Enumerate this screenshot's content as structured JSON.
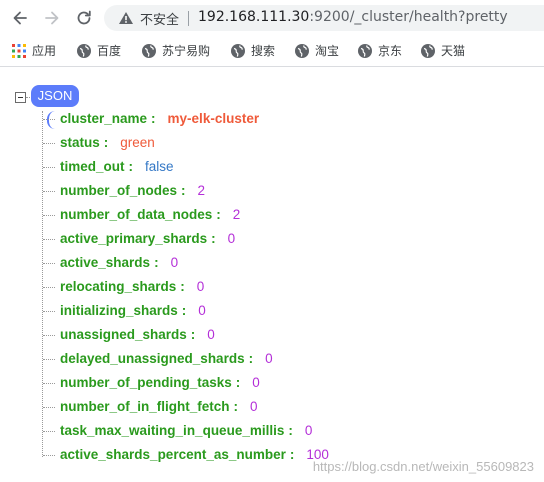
{
  "browser": {
    "security_label": "不安全",
    "url_host": "192.168.111.30",
    "url_rest": ":9200/_cluster/health?pretty"
  },
  "bookmarks": [
    {
      "label": "应用",
      "icon": "apps-grid-icon"
    },
    {
      "label": "百度",
      "icon": "globe-icon"
    },
    {
      "label": "苏宁易购",
      "icon": "globe-icon"
    },
    {
      "label": "搜索",
      "icon": "globe-icon"
    },
    {
      "label": "淘宝",
      "icon": "globe-icon"
    },
    {
      "label": "京东",
      "icon": "globe-icon"
    },
    {
      "label": "天猫",
      "icon": "globe-icon"
    }
  ],
  "json_view": {
    "badge": "JSON",
    "rows": [
      {
        "key": "cluster_name",
        "value": "my-elk-cluster",
        "type": "string-strong"
      },
      {
        "key": "status",
        "value": "green",
        "type": "string"
      },
      {
        "key": "timed_out",
        "value": "false",
        "type": "boolean"
      },
      {
        "key": "number_of_nodes",
        "value": "2",
        "type": "number"
      },
      {
        "key": "number_of_data_nodes",
        "value": "2",
        "type": "number"
      },
      {
        "key": "active_primary_shards",
        "value": "0",
        "type": "number"
      },
      {
        "key": "active_shards",
        "value": "0",
        "type": "number"
      },
      {
        "key": "relocating_shards",
        "value": "0",
        "type": "number"
      },
      {
        "key": "initializing_shards",
        "value": "0",
        "type": "number"
      },
      {
        "key": "unassigned_shards",
        "value": "0",
        "type": "number"
      },
      {
        "key": "delayed_unassigned_shards",
        "value": "0",
        "type": "number"
      },
      {
        "key": "number_of_pending_tasks",
        "value": "0",
        "type": "number"
      },
      {
        "key": "number_of_in_flight_fetch",
        "value": "0",
        "type": "number"
      },
      {
        "key": "task_max_waiting_in_queue_millis",
        "value": "0",
        "type": "number"
      },
      {
        "key": "active_shards_percent_as_number",
        "value": "100",
        "type": "number"
      }
    ]
  },
  "watermark": "https://blog.csdn.net/weixin_55609823",
  "colors": {
    "key": "#2a9a1d",
    "string": "#ef5a3a",
    "boolean": "#3478c6",
    "number": "#b42fd8",
    "badge": "#5c7cfa"
  }
}
